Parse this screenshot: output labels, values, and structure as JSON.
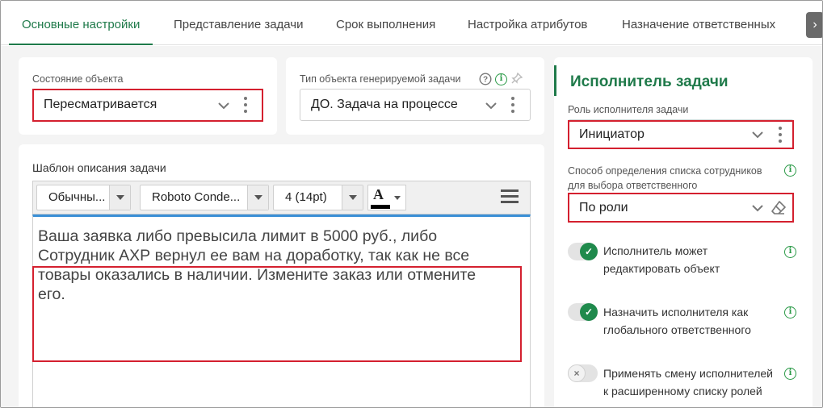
{
  "tabs": [
    {
      "label": "Основные настройки",
      "active": true
    },
    {
      "label": "Представление задачи"
    },
    {
      "label": "Срок выполнения"
    },
    {
      "label": "Настройка атрибутов"
    },
    {
      "label": "Назначение ответственных"
    }
  ],
  "tabs_next_icon": "chevron-right-icon",
  "object_state": {
    "label": "Состояние объекта",
    "value": "Пересматривается"
  },
  "task_object_type": {
    "label": "Тип объекта генерируемой задачи",
    "value": "ДО. Задача на процессе"
  },
  "template": {
    "label": "Шаблон описания задачи",
    "toolbar": {
      "style": "Обычны...",
      "font": "Roboto Conde...",
      "size": "4 (14pt)",
      "font_color_letter": "A",
      "font_color": "#000000"
    },
    "text": "Ваша заявка либо превысила лимит в 5000 руб., либо Сотрудник АХР вернул ее вам на доработку, так как не все товары оказались в наличии. Измените заказ или отмените его.",
    "lines": [
      "Ваша заявка либо превысила лимит в 5000 руб., либо",
      "Сотрудник АХР вернул ее вам на доработку, так как не все",
      "товары оказались в наличии. Измените заказ или отмените",
      "его."
    ]
  },
  "executor": {
    "title": "Исполнитель задачи",
    "role_label": "Роль исполнителя задачи",
    "role_value": "Инициатор",
    "method_label_line1": "Способ определения списка сотрудников",
    "method_label_line2": "для выбора ответственного",
    "method_value": "По роли",
    "toggles": [
      {
        "line1": "Исполнитель может",
        "line2": "редактировать объект",
        "on": true
      },
      {
        "line1": "Назначить исполнителя как",
        "line2": "глобального ответственного",
        "on": true
      },
      {
        "line1": "Применять смену исполнителей",
        "line2": "к расширенному списку ролей",
        "on": false
      }
    ]
  },
  "colors": {
    "accent": "#1f7a4a",
    "highlight": "#d4202f",
    "info": "#2a9a47",
    "editor_focus": "#3a8fd6"
  }
}
